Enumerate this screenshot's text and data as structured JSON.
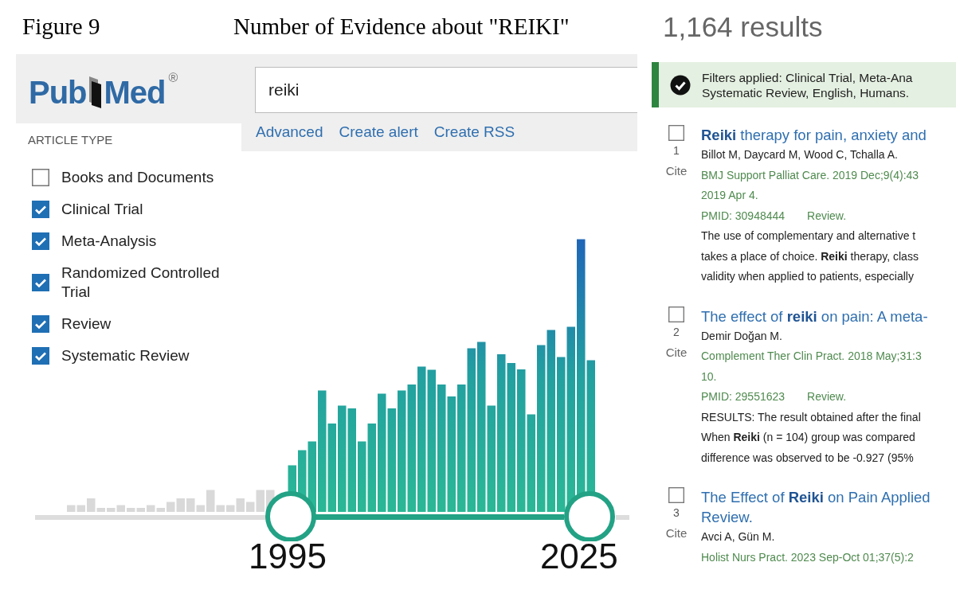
{
  "figure": {
    "label": "Figure 9",
    "title": "Number of Evidence about \"REIKI\""
  },
  "logo": {
    "left": "Pub",
    "right": "Med",
    "registered": "®"
  },
  "search": {
    "value": "reiki"
  },
  "search_links": [
    "Advanced",
    "Create alert",
    "Create RSS"
  ],
  "sidebar": {
    "heading": "ARTICLE TYPE",
    "items": [
      {
        "label": "Books and Documents",
        "checked": false
      },
      {
        "label": "Clinical Trial",
        "checked": true
      },
      {
        "label": "Meta-Analysis",
        "checked": true
      },
      {
        "label": "Randomized Controlled Trial",
        "checked": true
      },
      {
        "label": "Review",
        "checked": true
      },
      {
        "label": "Systematic Review",
        "checked": true
      }
    ]
  },
  "timeline": {
    "start_year": "1995",
    "end_year": "2025"
  },
  "results_count": "1,164 results",
  "filter_banner": {
    "lines": [
      "Filters applied: Clinical Trial, Meta-Ana",
      "Systematic Review, English, Humans."
    ]
  },
  "results": [
    {
      "number": "1",
      "cite": "Cite",
      "checked": false,
      "title_lines": [
        "**Reiki** therapy for pain, anxiety and"
      ],
      "authors": "Billot M, Daycard M, Wood C, Tchalla A.",
      "citation_lines": [
        "BMJ Support Palliat Care. 2019 Dec;9(4):43",
        "2019 Apr 4."
      ],
      "pmid": "PMID: 30948444",
      "pub_type": "Review.",
      "snippet_lines": [
        "The use of complementary and alternative t",
        "takes a place of choice. **Reiki** therapy, class",
        "validity when applied to patients, especially"
      ]
    },
    {
      "number": "2",
      "cite": "Cite",
      "checked": false,
      "title_lines": [
        "The effect of **reiki** on pain: A meta-"
      ],
      "authors": "Demir Doğan M.",
      "citation_lines": [
        "Complement Ther Clin Pract. 2018 May;31:3",
        "10."
      ],
      "pmid": "PMID: 29551623",
      "pub_type": "Review.",
      "snippet_lines": [
        "RESULTS: The result obtained after the final",
        "When **Reiki** (n = 104) group was compared",
        "difference was observed to be -0.927 (95%"
      ]
    },
    {
      "number": "3",
      "cite": "Cite",
      "checked": false,
      "title_lines": [
        "The Effect of **Reiki** on Pain Applied",
        "Review."
      ],
      "authors": "Avci A, Gün M.",
      "citation_lines": [
        "Holist Nurs Pract. 2023 Sep-Oct 01;37(5):2"
      ]
    }
  ]
}
